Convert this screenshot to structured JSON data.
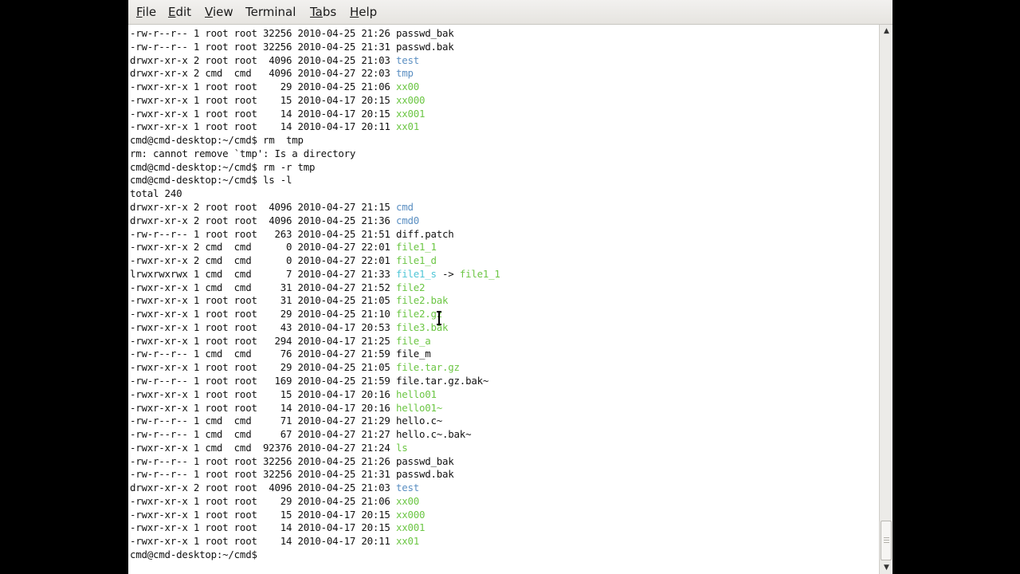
{
  "menubar": {
    "items": [
      {
        "label": "File",
        "mnemonic": "F",
        "rest": "ile"
      },
      {
        "label": "Edit",
        "mnemonic": "E",
        "rest": "dit"
      },
      {
        "label": "View",
        "mnemonic": "V",
        "rest": "iew"
      },
      {
        "label": "Terminal",
        "mnemonic": "",
        "rest": "Terminal"
      },
      {
        "label": "Tabs",
        "mnemonic": "Ta",
        "rest": "bs"
      },
      {
        "label": "Help",
        "mnemonic": "H",
        "rest": "elp"
      }
    ]
  },
  "terminal": {
    "lines": [
      {
        "text": "-rw-r--r-- 1 root root 32256 2010-04-25 21:26 ",
        "name": "passwd_bak",
        "ncolor": "plain"
      },
      {
        "text": "-rw-r--r-- 1 root root 32256 2010-04-25 21:31 ",
        "name": "passwd.bak",
        "ncolor": "plain"
      },
      {
        "text": "drwxr-xr-x 2 root root  4096 2010-04-25 21:03 ",
        "name": "test",
        "ncolor": "dir"
      },
      {
        "text": "drwxr-xr-x 2 cmd  cmd   4096 2010-04-27 22:03 ",
        "name": "tmp",
        "ncolor": "dir"
      },
      {
        "text": "-rwxr-xr-x 1 root root    29 2010-04-25 21:06 ",
        "name": "xx00",
        "ncolor": "exe"
      },
      {
        "text": "-rwxr-xr-x 1 root root    15 2010-04-17 20:15 ",
        "name": "xx000",
        "ncolor": "exe"
      },
      {
        "text": "-rwxr-xr-x 1 root root    14 2010-04-17 20:15 ",
        "name": "xx001",
        "ncolor": "exe"
      },
      {
        "text": "-rwxr-xr-x 1 root root    14 2010-04-17 20:11 ",
        "name": "xx01",
        "ncolor": "exe"
      },
      {
        "text": "cmd@cmd-desktop:~/cmd$ rm  tmp",
        "name": "",
        "ncolor": "plain"
      },
      {
        "text": "rm: cannot remove `tmp': Is a directory",
        "name": "",
        "ncolor": "plain"
      },
      {
        "text": "cmd@cmd-desktop:~/cmd$ rm -r tmp",
        "name": "",
        "ncolor": "plain"
      },
      {
        "text": "cmd@cmd-desktop:~/cmd$ ls -l",
        "name": "",
        "ncolor": "plain"
      },
      {
        "text": "total 240",
        "name": "",
        "ncolor": "plain"
      },
      {
        "text": "drwxr-xr-x 2 root root  4096 2010-04-27 21:15 ",
        "name": "cmd",
        "ncolor": "dir"
      },
      {
        "text": "drwxr-xr-x 2 root root  4096 2010-04-25 21:36 ",
        "name": "cmd0",
        "ncolor": "dir"
      },
      {
        "text": "-rw-r--r-- 1 root root   263 2010-04-25 21:51 ",
        "name": "diff.patch",
        "ncolor": "plain"
      },
      {
        "text": "-rwxr-xr-x 2 cmd  cmd      0 2010-04-27 22:01 ",
        "name": "file1_1",
        "ncolor": "exe"
      },
      {
        "text": "-rwxr-xr-x 2 cmd  cmd      0 2010-04-27 22:01 ",
        "name": "file1_d",
        "ncolor": "exe"
      },
      {
        "text": "lrwxrwxrwx 1 cmd  cmd      7 2010-04-27 21:33 ",
        "name": "file1_s",
        "ncolor": "link",
        "suffix": " -> ",
        "target": "file1_1"
      },
      {
        "text": "-rwxr-xr-x 1 cmd  cmd     31 2010-04-27 21:52 ",
        "name": "file2",
        "ncolor": "exe"
      },
      {
        "text": "-rwxr-xr-x 1 root root    31 2010-04-25 21:05 ",
        "name": "file2.bak",
        "ncolor": "exe"
      },
      {
        "text": "-rwxr-xr-x 1 root root    29 2010-04-25 21:10 ",
        "name": "file2.gz",
        "ncolor": "exe"
      },
      {
        "text": "-rwxr-xr-x 1 root root    43 2010-04-17 20:53 ",
        "name": "file3.bak",
        "ncolor": "exe"
      },
      {
        "text": "-rwxr-xr-x 1 root root   294 2010-04-17 21:25 ",
        "name": "file_a",
        "ncolor": "exe"
      },
      {
        "text": "-rw-r--r-- 1 cmd  cmd     76 2010-04-27 21:59 ",
        "name": "file_m",
        "ncolor": "plain"
      },
      {
        "text": "-rwxr-xr-x 1 root root    29 2010-04-25 21:05 ",
        "name": "file.tar.gz",
        "ncolor": "exe"
      },
      {
        "text": "-rw-r--r-- 1 root root   169 2010-04-25 21:59 ",
        "name": "file.tar.gz.bak~",
        "ncolor": "plain"
      },
      {
        "text": "-rwxr-xr-x 1 root root    15 2010-04-17 20:16 ",
        "name": "hello01",
        "ncolor": "exe"
      },
      {
        "text": "-rwxr-xr-x 1 root root    14 2010-04-17 20:16 ",
        "name": "hello01~",
        "ncolor": "exe"
      },
      {
        "text": "-rw-r--r-- 1 cmd  cmd     71 2010-04-27 21:29 ",
        "name": "hello.c~",
        "ncolor": "plain"
      },
      {
        "text": "-rw-r--r-- 1 cmd  cmd     67 2010-04-27 21:27 ",
        "name": "hello.c~.bak~",
        "ncolor": "plain"
      },
      {
        "text": "-rwxr-xr-x 1 cmd  cmd  92376 2010-04-27 21:24 ",
        "name": "ls",
        "ncolor": "exe"
      },
      {
        "text": "-rw-r--r-- 1 root root 32256 2010-04-25 21:26 ",
        "name": "passwd_bak",
        "ncolor": "plain"
      },
      {
        "text": "-rw-r--r-- 1 root root 32256 2010-04-25 21:31 ",
        "name": "passwd.bak",
        "ncolor": "plain"
      },
      {
        "text": "drwxr-xr-x 2 root root  4096 2010-04-25 21:03 ",
        "name": "test",
        "ncolor": "dir"
      },
      {
        "text": "-rwxr-xr-x 1 root root    29 2010-04-25 21:06 ",
        "name": "xx00",
        "ncolor": "exe"
      },
      {
        "text": "-rwxr-xr-x 1 root root    15 2010-04-17 20:15 ",
        "name": "xx000",
        "ncolor": "exe"
      },
      {
        "text": "-rwxr-xr-x 1 root root    14 2010-04-17 20:15 ",
        "name": "xx001",
        "ncolor": "exe"
      },
      {
        "text": "-rwxr-xr-x 1 root root    14 2010-04-17 20:11 ",
        "name": "xx01",
        "ncolor": "exe"
      },
      {
        "text": "cmd@cmd-desktop:~/cmd$ ",
        "name": "",
        "ncolor": "plain"
      }
    ]
  },
  "scrollbar": {
    "up_icon": "up-arrow-icon",
    "down_icon": "down-arrow-icon",
    "position": 1.0
  },
  "colors": {
    "directory": "#5b8fc2",
    "executable": "#6cc644",
    "symlink": "#4fc6d6",
    "background": "#ffffff",
    "text": "#111111"
  }
}
